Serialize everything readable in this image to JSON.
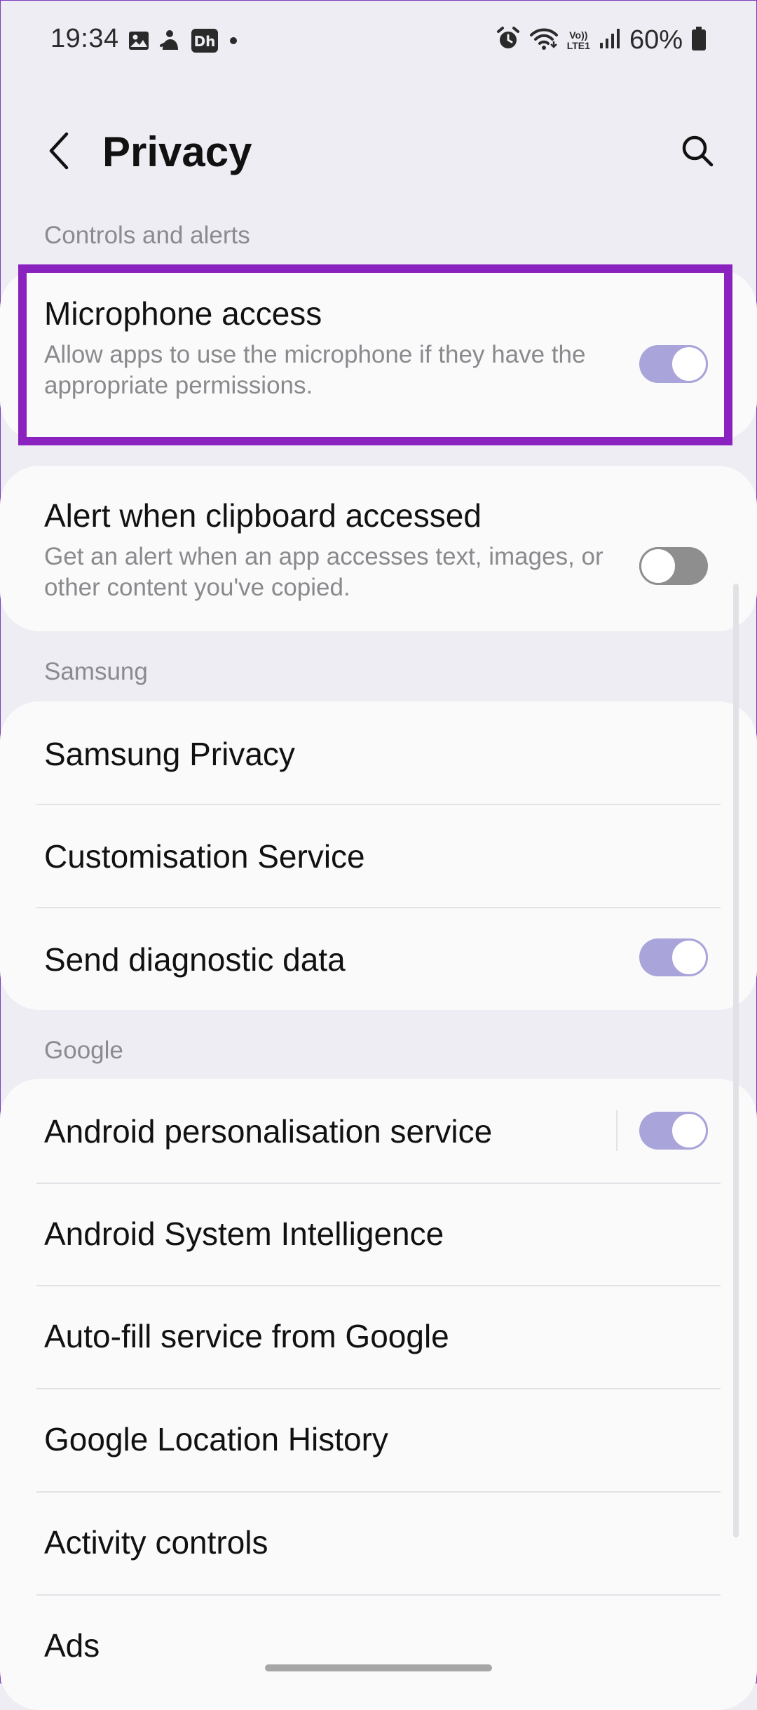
{
  "status_bar": {
    "time": "19:34",
    "battery_percent": "60%",
    "network_top": "Vo))",
    "network_bottom": "LTE1",
    "icons_left": [
      "gallery-icon",
      "app-notification-icon",
      "disney-hotstar-icon",
      "dot-icon"
    ],
    "icons_right": [
      "alarm-icon",
      "wifi-icon",
      "volte-lte-icon",
      "signal-icon",
      "battery-icon"
    ]
  },
  "header": {
    "title": "Privacy",
    "back_icon": "chevron-left-icon",
    "search_icon": "search-icon"
  },
  "sections": {
    "controls": {
      "header": "Controls and alerts",
      "microphone": {
        "title": "Microphone access",
        "subtitle": "Allow apps to use the microphone if they have the appropriate permissions.",
        "enabled": true
      },
      "clipboard": {
        "title": "Alert when clipboard accessed",
        "subtitle": "Get an alert when an app accesses text, images, or other content you've copied.",
        "enabled": false
      }
    },
    "samsung": {
      "header": "Samsung",
      "items": [
        {
          "label": "Samsung Privacy"
        },
        {
          "label": "Customisation Service"
        },
        {
          "label": "Send diagnostic data",
          "enabled": true
        }
      ]
    },
    "google": {
      "header": "Google",
      "items": [
        {
          "label": "Android personalisation service",
          "enabled": true
        },
        {
          "label": "Android System Intelligence"
        },
        {
          "label": "Auto-fill service from Google"
        },
        {
          "label": "Google Location History"
        },
        {
          "label": "Activity controls"
        },
        {
          "label": "Ads"
        }
      ]
    }
  },
  "colors": {
    "background": "#eeedf3",
    "card": "#fafafa",
    "toggle_on": "#a9a4da",
    "toggle_off": "#8e8e8e",
    "highlight": "#8a22bf"
  }
}
